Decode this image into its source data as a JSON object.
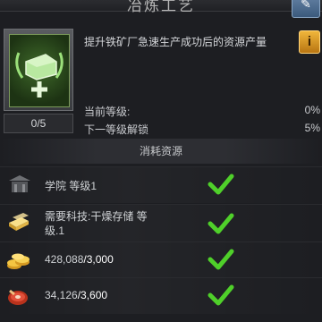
{
  "header": {
    "title": "冶炼工艺"
  },
  "upgrade": {
    "level": "0/5",
    "description": "提升铁矿厂急速生产成功后的资源产量",
    "current_label": "当前等级:",
    "current_value": "0%",
    "next_label": "下一等级解锁",
    "next_value": "5%"
  },
  "section": {
    "title": "消耗资源"
  },
  "requirements": [
    {
      "text": "学院 等级1",
      "icon": "academy-icon",
      "met": true
    },
    {
      "text_line1": "需要科技:干燥存储 等",
      "text_line2": "级.1",
      "icon": "gold-bar-icon",
      "met": true
    },
    {
      "amount": "428,088",
      "required": "/3,000",
      "icon": "gold-coins-icon",
      "met": true
    },
    {
      "amount": "34,126",
      "required": "/3,600",
      "icon": "meat-icon",
      "met": true
    }
  ],
  "colors": {
    "check": "#4fd02a",
    "accent": "#f0b63b",
    "ok_text": "#cfd2d5"
  }
}
